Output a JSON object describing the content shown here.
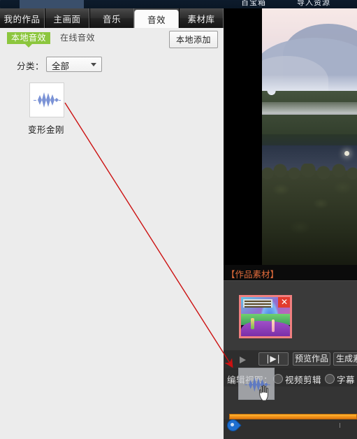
{
  "window": {
    "top_menu": [
      "百宝箱",
      "导入资源"
    ]
  },
  "left_panel": {
    "tabs": [
      {
        "label": "我的作品",
        "active": false
      },
      {
        "label": "主画面",
        "active": false
      },
      {
        "label": "音乐",
        "active": false
      },
      {
        "label": "音效",
        "active": true
      },
      {
        "label": "素材库",
        "active": false
      }
    ],
    "sub_tabs": {
      "local_badge": "本地音效",
      "online_link": "在线音效"
    },
    "add_local_button": "本地添加",
    "filter": {
      "label": "分类：",
      "selected": "全部",
      "options": [
        "全部"
      ]
    },
    "items": [
      {
        "label": "变形金刚",
        "icon": "audio-waveform-icon"
      }
    ]
  },
  "right_panel": {
    "materials_header": "【作品素材】",
    "material_items": [
      {
        "close_label": "✕"
      }
    ],
    "controls": {
      "play_label": "",
      "step_label": "|▶|",
      "preview_label": "预览作品",
      "generate_label": "生成素"
    },
    "edit_view": {
      "label": "编辑视图：",
      "options": [
        {
          "label": "视频剪辑",
          "selected": false
        },
        {
          "label": "字幕",
          "selected": false
        }
      ]
    },
    "drag_item": {
      "icon": "audio-waveform-icon"
    }
  },
  "colors": {
    "accent_green": "#8cc63e",
    "timeline_orange": "#f0901a",
    "playhead_blue": "#1f6fd0",
    "annotation_red": "#cc1111",
    "material_border": "#f08080",
    "materials_title": "#e06b3b"
  }
}
